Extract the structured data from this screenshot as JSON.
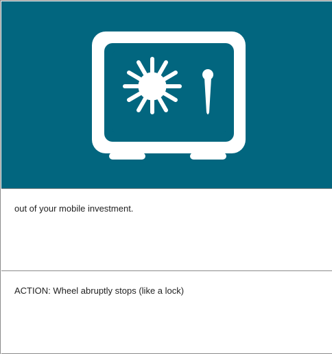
{
  "hero": {
    "background": "#02667f",
    "icon": "safe-vault-icon",
    "icon_color": "#ffffff"
  },
  "panels": [
    {
      "text": "out of your mobile investment."
    },
    {
      "text": "ACTION: Wheel abruptly stops (like a lock)"
    }
  ]
}
